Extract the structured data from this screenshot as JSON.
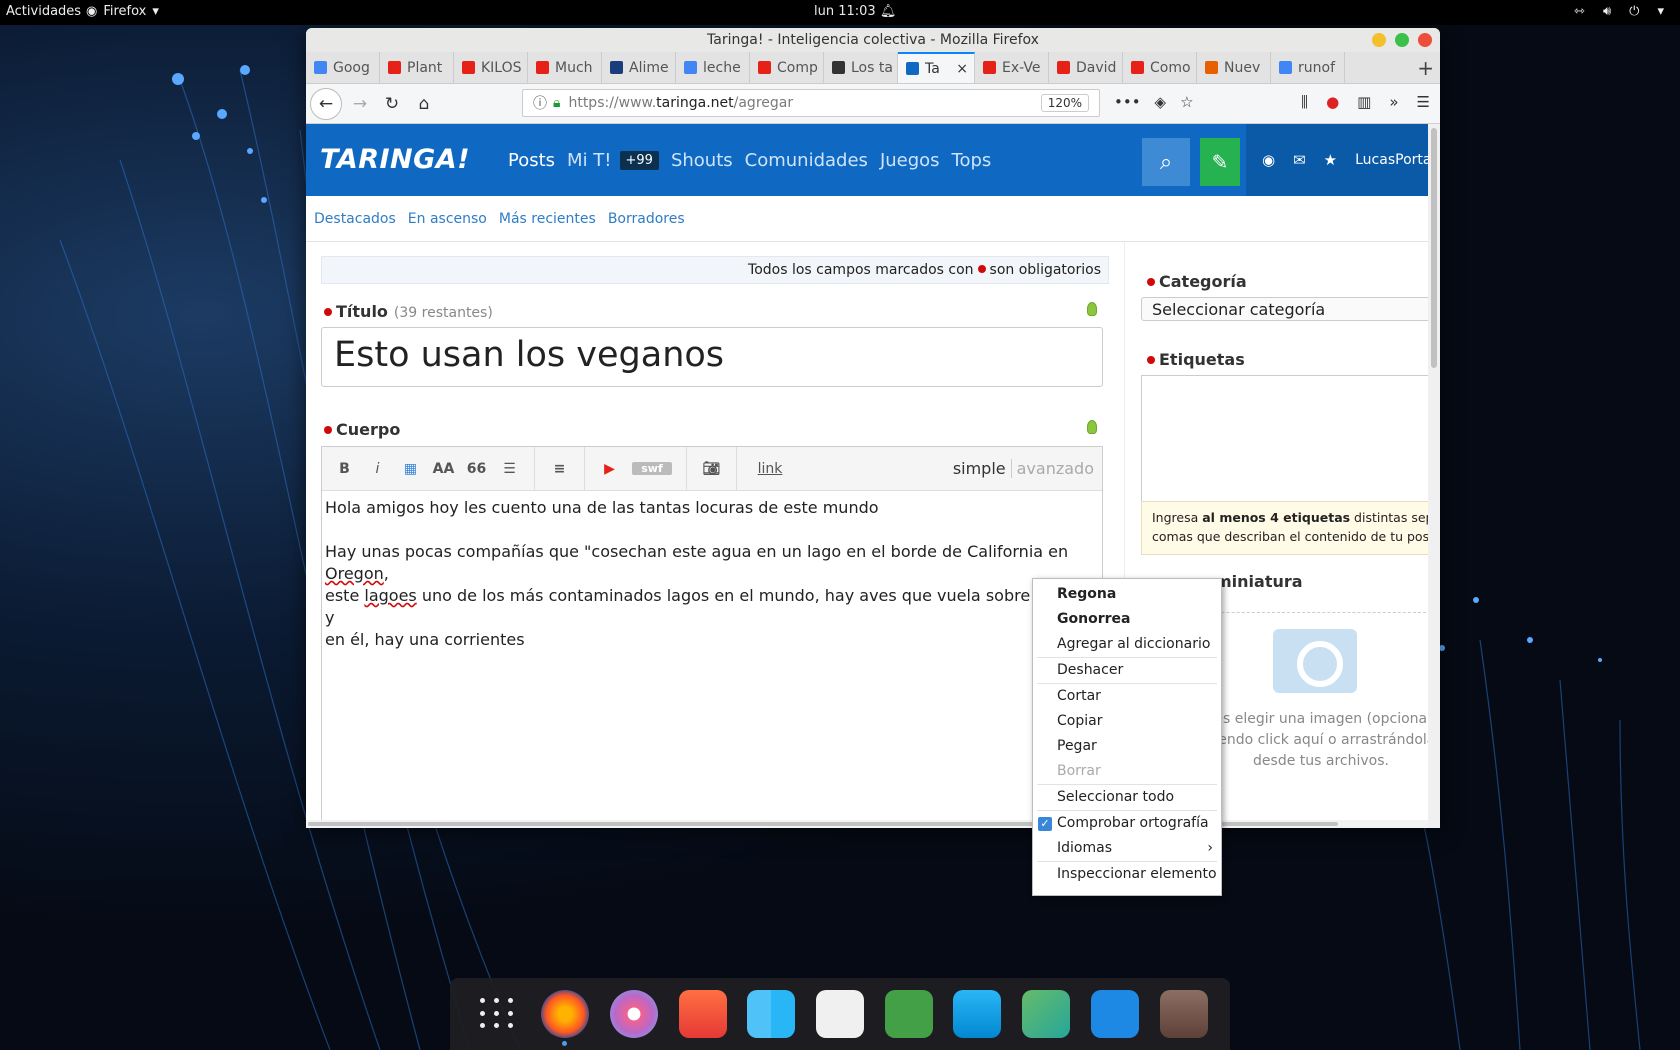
{
  "topbar": {
    "activities": "Actividades",
    "app": "Firefox",
    "clock": "lun 11:03",
    "sys_icons": [
      "network-icon",
      "volume-icon",
      "power-icon"
    ]
  },
  "window": {
    "title": "Taringa! - Inteligencia colectiva - Mozilla Firefox",
    "tabs": [
      {
        "label": "Goog",
        "color": "#4285f4"
      },
      {
        "label": "Plant",
        "color": "#e62117"
      },
      {
        "label": "KILOS",
        "color": "#e62117"
      },
      {
        "label": "Much",
        "color": "#e62117"
      },
      {
        "label": "Alime",
        "color": "#1a3d7c"
      },
      {
        "label": "leche",
        "color": "#4285f4"
      },
      {
        "label": "Comp",
        "color": "#e62117"
      },
      {
        "label": "Los ta",
        "color": "#333333"
      },
      {
        "label": "Ta",
        "color": "#0f69c2",
        "active": true
      },
      {
        "label": "Ex-Ve",
        "color": "#e62117"
      },
      {
        "label": "David",
        "color": "#e62117"
      },
      {
        "label": "Como",
        "color": "#e62117"
      },
      {
        "label": "Nuev",
        "color": "#e66000"
      },
      {
        "label": "runof",
        "color": "#4285f4"
      }
    ],
    "url_prefix": "https://www.",
    "url_domain": "taringa.net",
    "url_path": "/agregar",
    "zoom": "120%"
  },
  "site": {
    "logo": "TARINGA!",
    "nav": [
      "Posts",
      "Mi T!",
      "Shouts",
      "Comunidades",
      "Juegos",
      "Tops"
    ],
    "badge": "+99",
    "username": "LucasPorta",
    "subnav": [
      "Destacados",
      "En ascenso",
      "Más recientes",
      "Borradores"
    ]
  },
  "form": {
    "required_note_a": "Todos los campos marcados con",
    "required_note_b": "son obligatorios",
    "title_label": "Título",
    "title_remaining": "(39 restantes)",
    "title_value": "Esto usan los veganos",
    "body_label": "Cuerpo",
    "toolbar": {
      "bold": "B",
      "italic": "i",
      "size": "AA",
      "quote": "66",
      "link": "link",
      "simple": "simple",
      "advanced": "avanzado",
      "swf": "swf"
    },
    "body_line1": "Hola amigos hoy les cuento una de las tantas locuras de este mundo",
    "body_line2a": "Hay unas pocas compañías que \"cosechan este agua en un lago en el borde de California en ",
    "body_line2b": "Oregon",
    "body_line2c": ",",
    "body_line3a": "este ",
    "body_line3b": "lagoes",
    "body_line3c": " uno de los más contaminados lagos en el mundo, hay aves que vuela sobre el lago y",
    "body_line4": "en él, hay una corrientes"
  },
  "sidebar": {
    "category_label": "Categoría",
    "category_value": "Seleccionar categoría",
    "tags_label": "Etiquetas",
    "tags_note_a": "Ingresa ",
    "tags_note_b": "al menos 4 etiquetas",
    "tags_note_c": " distintas separada",
    "tags_note_d": "comas que describan el contenido de tu post.",
    "thumb_label": "miniatura",
    "thumb_text": "des elegir una imagen (opcional) ciendo click aquí o arrastrándola desde tus archivos."
  },
  "context_menu": {
    "items": [
      {
        "label": "Regona",
        "bold": true
      },
      {
        "label": "Gonorrea",
        "bold": true
      },
      {
        "label": "Agregar al diccionario"
      },
      {
        "label": "Deshacer"
      },
      {
        "label": "Cortar"
      },
      {
        "label": "Copiar"
      },
      {
        "label": "Pegar"
      },
      {
        "label": "Borrar",
        "disabled": true
      },
      {
        "label": "Seleccionar todo"
      },
      {
        "label": "Comprobar ortografía",
        "checked": true
      },
      {
        "label": "Idiomas",
        "submenu": true
      },
      {
        "label": "Inspeccionar elemento"
      }
    ]
  },
  "dock": [
    "apps-grid-icon",
    "firefox-icon",
    "music-icon",
    "photo-booth-icon",
    "finder-icon",
    "gimp-icon",
    "facetime-icon",
    "weather-icon",
    "maps-icon",
    "writer-icon",
    "calculator-icon"
  ]
}
